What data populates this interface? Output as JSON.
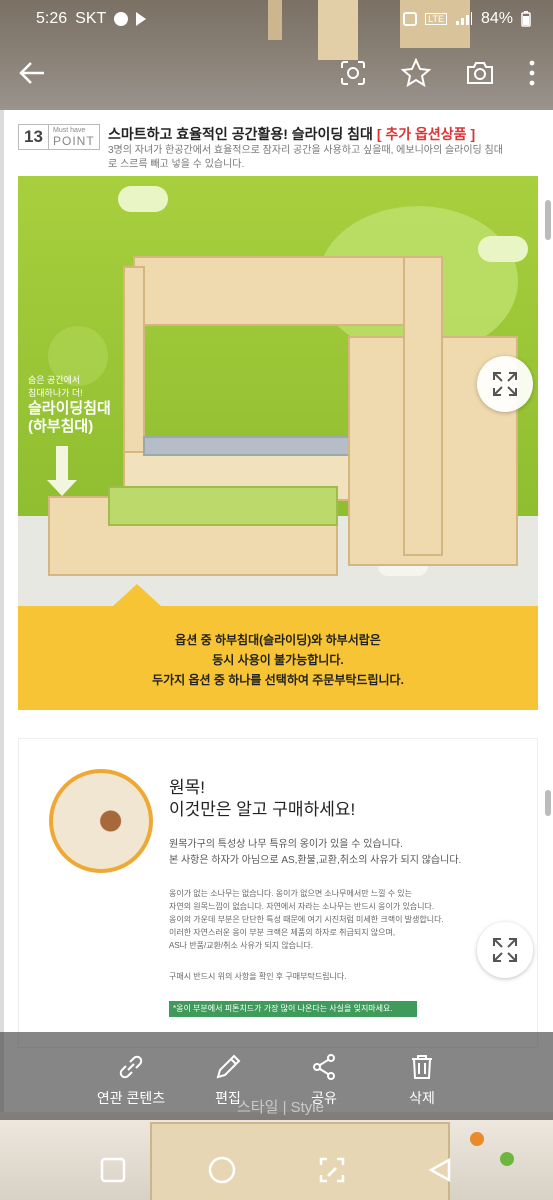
{
  "status": {
    "time": "5:26",
    "carrier": "SKT",
    "battery": "84%"
  },
  "section": {
    "number": "13",
    "must_have": "Must have",
    "point": "POINT",
    "title": "스마트하고 효율적인 공간활용! 슬라이딩 침대",
    "title_option": "[ 추가 옵션상품 ]",
    "description": "3명의 자녀가 한공간에서 효율적으로 잠자리 공간을 사용하고 싶을때, 에보니아의 슬라이딩 침대로 스르륵 빼고 넣을 수 있습니다."
  },
  "scene": {
    "side_small_1": "숨은 공간에서",
    "side_small_2": "침대하나가 더!",
    "side_big_1": "슬라이딩침대",
    "side_big_2": "(하부침대)"
  },
  "notice": {
    "line1": "옵션 중 하부침대(슬라이딩)와 하부서랍은",
    "line2": "동시 사용이 불가능합니다.",
    "line3": "두가지 옵션 중 하나를 선택하여 주문부탁드립니다."
  },
  "wood": {
    "heading1": "원목!",
    "heading2": "이것만은 알고 구매하세요!",
    "para1_line1": "원목가구의 특성상 나무 특유의 옹이가 있을 수 있습니다.",
    "para1_line2": "본 사항은 하자가 아님으로 AS,환불,교환,취소의 사유가 되지 않습니다.",
    "para2_line1": "옹이가 없는 소나무는 없습니다. 옹이가 없으면 소나무에서만 느낄 수 있는",
    "para2_line2": "자연의 원목느낌이 없습니다. 자연에서 자라는 소나무는 반드시 옹이가 있습니다.",
    "para2_line3": "옹이의 가운데 부분은 단단한 특성 때문에 여기 시진처럼 미세한 크랙이 발생합니다.",
    "para2_line4": "이러한 자연스러운 옹이 부분 크랙은 제품의 하자로 취급되지 않으며,",
    "para2_line5": "AS나 반품/교환/취소 사유가 되지 않습니다.",
    "para3": "구매시 반드시 위의 사항을 확인 후 구매부탁드립니다.",
    "green_note": "*옹이 부분에서 피톤치드가 가장 많이 나온다는 사실을 잊지마세요."
  },
  "actions": {
    "related": "연관 콘텐츠",
    "edit": "편집",
    "share": "공유",
    "delete": "삭제",
    "watermark": "스타일 | Style"
  },
  "colors": {
    "accent": "#f7c436",
    "option_red": "#d33333",
    "wall_green": "#9ec93a",
    "note_green": "#3f9b5b"
  }
}
